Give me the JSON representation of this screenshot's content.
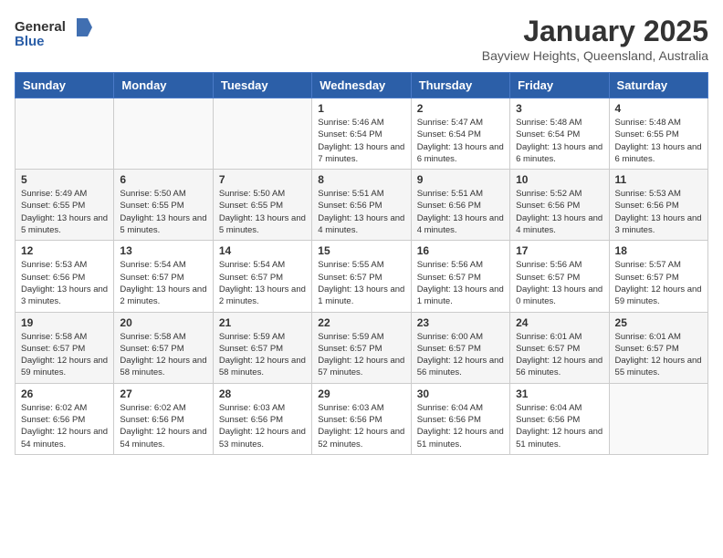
{
  "header": {
    "logo": {
      "general": "General",
      "blue": "Blue"
    },
    "title": "January 2025",
    "location": "Bayview Heights, Queensland, Australia"
  },
  "calendar": {
    "weekdays": [
      "Sunday",
      "Monday",
      "Tuesday",
      "Wednesday",
      "Thursday",
      "Friday",
      "Saturday"
    ],
    "weeks": [
      [
        null,
        null,
        null,
        {
          "day": "1",
          "sunrise": "Sunrise: 5:46 AM",
          "sunset": "Sunset: 6:54 PM",
          "daylight": "Daylight: 13 hours and 7 minutes."
        },
        {
          "day": "2",
          "sunrise": "Sunrise: 5:47 AM",
          "sunset": "Sunset: 6:54 PM",
          "daylight": "Daylight: 13 hours and 6 minutes."
        },
        {
          "day": "3",
          "sunrise": "Sunrise: 5:48 AM",
          "sunset": "Sunset: 6:54 PM",
          "daylight": "Daylight: 13 hours and 6 minutes."
        },
        {
          "day": "4",
          "sunrise": "Sunrise: 5:48 AM",
          "sunset": "Sunset: 6:55 PM",
          "daylight": "Daylight: 13 hours and 6 minutes."
        }
      ],
      [
        {
          "day": "5",
          "sunrise": "Sunrise: 5:49 AM",
          "sunset": "Sunset: 6:55 PM",
          "daylight": "Daylight: 13 hours and 5 minutes."
        },
        {
          "day": "6",
          "sunrise": "Sunrise: 5:50 AM",
          "sunset": "Sunset: 6:55 PM",
          "daylight": "Daylight: 13 hours and 5 minutes."
        },
        {
          "day": "7",
          "sunrise": "Sunrise: 5:50 AM",
          "sunset": "Sunset: 6:55 PM",
          "daylight": "Daylight: 13 hours and 5 minutes."
        },
        {
          "day": "8",
          "sunrise": "Sunrise: 5:51 AM",
          "sunset": "Sunset: 6:56 PM",
          "daylight": "Daylight: 13 hours and 4 minutes."
        },
        {
          "day": "9",
          "sunrise": "Sunrise: 5:51 AM",
          "sunset": "Sunset: 6:56 PM",
          "daylight": "Daylight: 13 hours and 4 minutes."
        },
        {
          "day": "10",
          "sunrise": "Sunrise: 5:52 AM",
          "sunset": "Sunset: 6:56 PM",
          "daylight": "Daylight: 13 hours and 4 minutes."
        },
        {
          "day": "11",
          "sunrise": "Sunrise: 5:53 AM",
          "sunset": "Sunset: 6:56 PM",
          "daylight": "Daylight: 13 hours and 3 minutes."
        }
      ],
      [
        {
          "day": "12",
          "sunrise": "Sunrise: 5:53 AM",
          "sunset": "Sunset: 6:56 PM",
          "daylight": "Daylight: 13 hours and 3 minutes."
        },
        {
          "day": "13",
          "sunrise": "Sunrise: 5:54 AM",
          "sunset": "Sunset: 6:57 PM",
          "daylight": "Daylight: 13 hours and 2 minutes."
        },
        {
          "day": "14",
          "sunrise": "Sunrise: 5:54 AM",
          "sunset": "Sunset: 6:57 PM",
          "daylight": "Daylight: 13 hours and 2 minutes."
        },
        {
          "day": "15",
          "sunrise": "Sunrise: 5:55 AM",
          "sunset": "Sunset: 6:57 PM",
          "daylight": "Daylight: 13 hours and 1 minute."
        },
        {
          "day": "16",
          "sunrise": "Sunrise: 5:56 AM",
          "sunset": "Sunset: 6:57 PM",
          "daylight": "Daylight: 13 hours and 1 minute."
        },
        {
          "day": "17",
          "sunrise": "Sunrise: 5:56 AM",
          "sunset": "Sunset: 6:57 PM",
          "daylight": "Daylight: 13 hours and 0 minutes."
        },
        {
          "day": "18",
          "sunrise": "Sunrise: 5:57 AM",
          "sunset": "Sunset: 6:57 PM",
          "daylight": "Daylight: 12 hours and 59 minutes."
        }
      ],
      [
        {
          "day": "19",
          "sunrise": "Sunrise: 5:58 AM",
          "sunset": "Sunset: 6:57 PM",
          "daylight": "Daylight: 12 hours and 59 minutes."
        },
        {
          "day": "20",
          "sunrise": "Sunrise: 5:58 AM",
          "sunset": "Sunset: 6:57 PM",
          "daylight": "Daylight: 12 hours and 58 minutes."
        },
        {
          "day": "21",
          "sunrise": "Sunrise: 5:59 AM",
          "sunset": "Sunset: 6:57 PM",
          "daylight": "Daylight: 12 hours and 58 minutes."
        },
        {
          "day": "22",
          "sunrise": "Sunrise: 5:59 AM",
          "sunset": "Sunset: 6:57 PM",
          "daylight": "Daylight: 12 hours and 57 minutes."
        },
        {
          "day": "23",
          "sunrise": "Sunrise: 6:00 AM",
          "sunset": "Sunset: 6:57 PM",
          "daylight": "Daylight: 12 hours and 56 minutes."
        },
        {
          "day": "24",
          "sunrise": "Sunrise: 6:01 AM",
          "sunset": "Sunset: 6:57 PM",
          "daylight": "Daylight: 12 hours and 56 minutes."
        },
        {
          "day": "25",
          "sunrise": "Sunrise: 6:01 AM",
          "sunset": "Sunset: 6:57 PM",
          "daylight": "Daylight: 12 hours and 55 minutes."
        }
      ],
      [
        {
          "day": "26",
          "sunrise": "Sunrise: 6:02 AM",
          "sunset": "Sunset: 6:56 PM",
          "daylight": "Daylight: 12 hours and 54 minutes."
        },
        {
          "day": "27",
          "sunrise": "Sunrise: 6:02 AM",
          "sunset": "Sunset: 6:56 PM",
          "daylight": "Daylight: 12 hours and 54 minutes."
        },
        {
          "day": "28",
          "sunrise": "Sunrise: 6:03 AM",
          "sunset": "Sunset: 6:56 PM",
          "daylight": "Daylight: 12 hours and 53 minutes."
        },
        {
          "day": "29",
          "sunrise": "Sunrise: 6:03 AM",
          "sunset": "Sunset: 6:56 PM",
          "daylight": "Daylight: 12 hours and 52 minutes."
        },
        {
          "day": "30",
          "sunrise": "Sunrise: 6:04 AM",
          "sunset": "Sunset: 6:56 PM",
          "daylight": "Daylight: 12 hours and 51 minutes."
        },
        {
          "day": "31",
          "sunrise": "Sunrise: 6:04 AM",
          "sunset": "Sunset: 6:56 PM",
          "daylight": "Daylight: 12 hours and 51 minutes."
        },
        null
      ]
    ]
  }
}
